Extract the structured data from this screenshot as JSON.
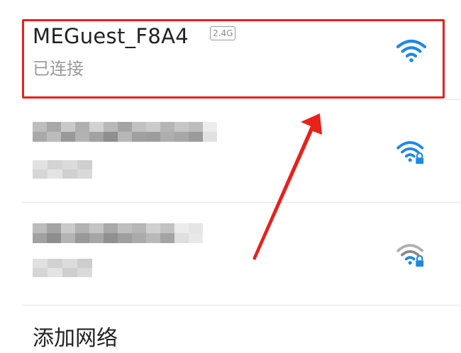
{
  "networks": {
    "connected": {
      "ssid": "MEGuest_F8A4",
      "band": "2.4G",
      "status": "已连接",
      "icon": "wifi-full-icon",
      "icon_color": "#1e88e5"
    },
    "secured_1": {
      "icon": "wifi-locked-icon",
      "icon_color": "#1e88e5"
    },
    "secured_2": {
      "icon": "wifi-locked-icon",
      "icon_color": "#8a8a8a"
    }
  },
  "add_network": {
    "label": "添加网络"
  },
  "annotation": {
    "color": "#e8211a"
  }
}
